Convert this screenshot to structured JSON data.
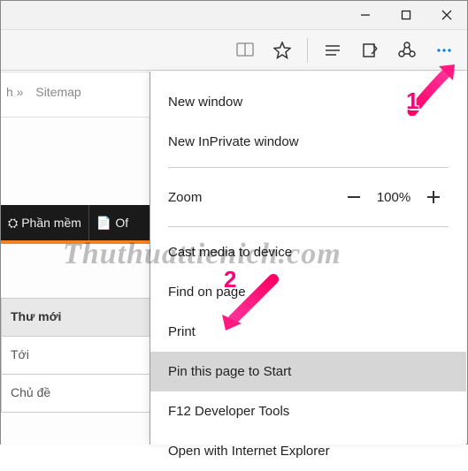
{
  "titlebar": {
    "minimize": "−",
    "maximize": "□",
    "close": "×"
  },
  "toolbar": {
    "reading_view": "reading-view-icon",
    "favorite": "star-icon",
    "hub": "hub-icon",
    "note": "webnote-icon",
    "share": "share-icon",
    "more": "more-icon"
  },
  "page": {
    "top_nav_left": "h »",
    "top_nav_sitemap": "Sitemap",
    "black_bar": {
      "item_pm_icon": "⛭",
      "item_pm_label": "Phần mềm",
      "item_of_icon": "📄",
      "item_of_label": "Of"
    },
    "white_tabs": {
      "t1": "Thư mới",
      "t2": "Tới",
      "t3": "Chủ đề"
    }
  },
  "menu": {
    "new_window": "New window",
    "new_inprivate": "New InPrivate window",
    "zoom_label": "Zoom",
    "zoom_value": "100%",
    "cast": "Cast media to device",
    "find": "Find on page",
    "print": "Print",
    "pin": "Pin this page to Start",
    "f12": "F12 Developer Tools",
    "open_ie": "Open with Internet Explorer"
  },
  "annotations": {
    "num1": "1",
    "num2": "2",
    "watermark": "Thuthuattienich.com"
  }
}
